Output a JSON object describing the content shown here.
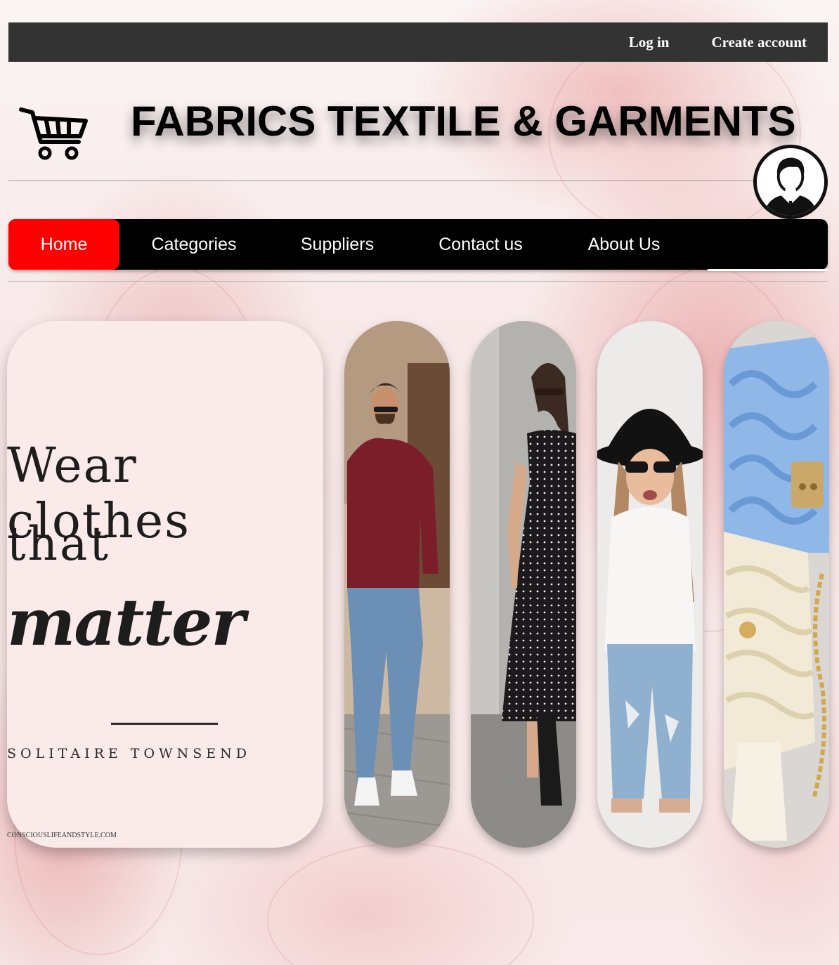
{
  "topbar": {
    "login_label": "Log in",
    "create_account_label": "Create account"
  },
  "header": {
    "title": "FABRICS TEXTILE & GARMENTS",
    "cart_icon": "shopping-cart-icon",
    "avatar_icon": "user-avatar-icon"
  },
  "nav": {
    "items": [
      {
        "label": "Home",
        "active": true
      },
      {
        "label": "Categories",
        "active": false
      },
      {
        "label": "Suppliers",
        "active": false
      },
      {
        "label": "Contact us",
        "active": false
      },
      {
        "label": "About Us",
        "active": false
      }
    ],
    "active_color": "#ff0000",
    "bar_color": "#000000"
  },
  "hero": {
    "quote_line1": "Wear clothes",
    "quote_line2": "that",
    "quote_line3": "matter",
    "author": "SOLITAIRE TOWNSEND",
    "site": "CONSCIOUSLIFEANDSTYLE.COM"
  },
  "gallery": [
    {
      "name": "man-in-red-sweater-photo"
    },
    {
      "name": "woman-in-polka-dot-dress-photo"
    },
    {
      "name": "girl-in-black-hat-photo"
    },
    {
      "name": "knitted-handbags-photo"
    }
  ],
  "colors": {
    "topbar": "#333333",
    "background": "#fbf3f3",
    "card": "#fbeaea"
  }
}
